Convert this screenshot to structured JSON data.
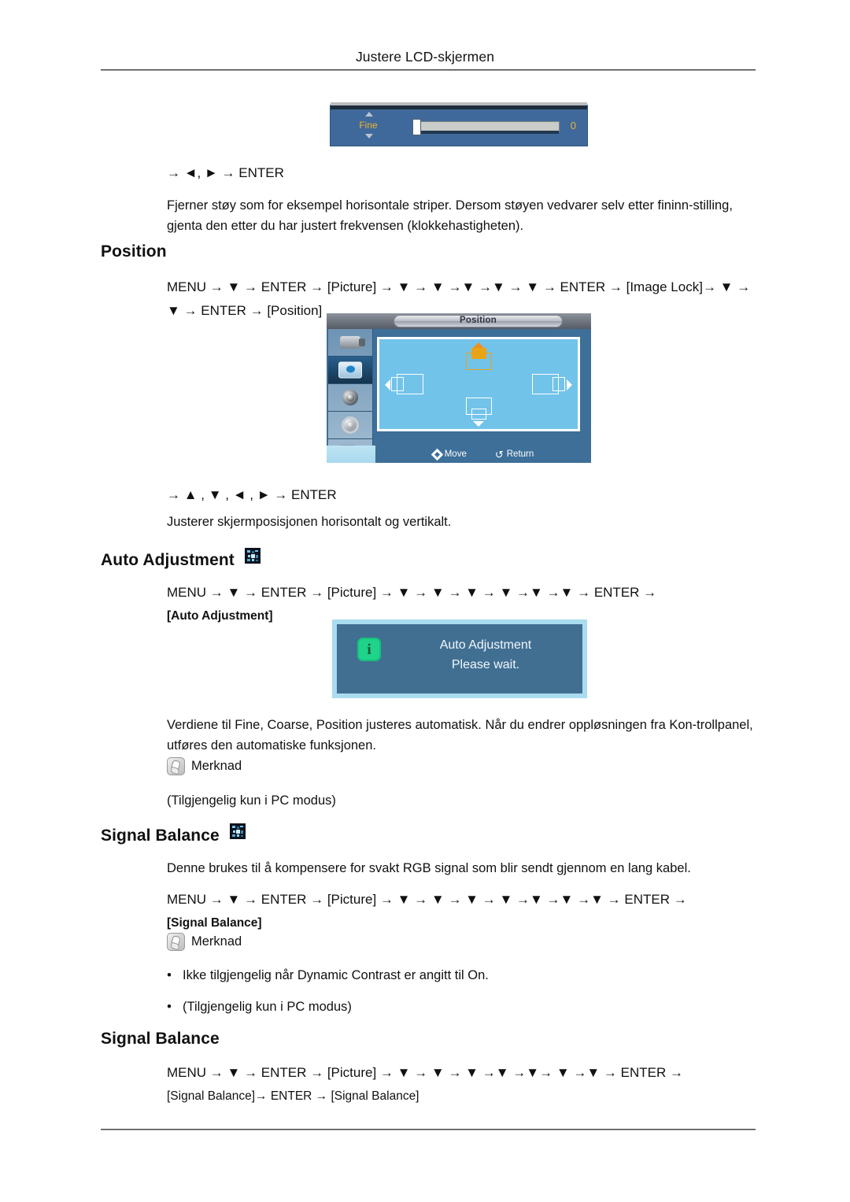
{
  "page": {
    "running_head": "Justere LCD-skjermen"
  },
  "fine_osd": {
    "label": "Fine",
    "value": "0",
    "up_icon": "triangle-up-icon",
    "down_icon": "triangle-down-icon"
  },
  "fine_section": {
    "keypath": "→ ◄, ► → ENTER",
    "description": "Fjerner støy som for eksempel horisontale striper. Dersom støyen vedvarer selv etter fininn-stilling, gjenta den etter du har justert frekvensen (klokkehastigheten)."
  },
  "position_section": {
    "heading": "Position",
    "path_line1": "MENU → ▼ → ENTER → [Picture] → ▼ → ▼ →▼ →▼ → ▼ → ENTER → [Image Lock]→ ▼ →",
    "path_line2": "▼ → ENTER → [Position]",
    "path_tokens": [
      "MENU",
      "ENTER",
      "Picture",
      "ENTER",
      "Image Lock",
      "ENTER",
      "Position"
    ],
    "keypath": "→ ▲ , ▼ , ◄ , ► → ENTER",
    "description": "Justerer skjermposisjonen horisontalt og vertikalt."
  },
  "position_osd": {
    "title": "Position",
    "sidebar": [
      {
        "name": "input-icon",
        "selected": false
      },
      {
        "name": "picture-icon",
        "selected": true
      },
      {
        "name": "sound-icon",
        "selected": false
      },
      {
        "name": "setup-icon",
        "selected": false
      },
      {
        "name": "multi-control-icon",
        "selected": false
      }
    ],
    "markers": [
      "up",
      "left",
      "right",
      "down"
    ],
    "footer": {
      "move": "Move",
      "return": "Return"
    }
  },
  "auto_adjustment_section": {
    "heading": "Auto Adjustment",
    "badge": "pc-mode-badge-icon",
    "path_line1": "MENU → ▼ → ENTER → [Picture] → ▼ → ▼ → ▼ → ▼ →▼ →▼ → ENTER →",
    "path_line2": "[Auto Adjustment]",
    "description": "Verdiene til Fine, Coarse, Position justeres automatisk. Når du endrer oppløsningen fra Kon-trollpanel, utføres den automatiske funksjonen.",
    "note_label": "Merknad",
    "note_text": "(Tilgjengelig kun i PC modus)"
  },
  "auto_adjustment_dialog": {
    "icon": "info-icon",
    "line1": "Auto Adjustment",
    "line2": "Please wait."
  },
  "signal_balance_section": {
    "heading": "Signal Balance",
    "badge": "pc-mode-badge-icon",
    "description": "Denne brukes til å kompensere for svakt RGB signal som blir sendt gjennom en lang kabel.",
    "path_line1": "MENU → ▼ → ENTER → [Picture] → ▼ → ▼ → ▼ → ▼ →▼ →▼ →▼ → ENTER →",
    "path_line2": "[Signal Balance]",
    "note_label": "Merknad",
    "bullets": [
      "Ikke tilgjengelig når Dynamic Contrast er angitt til On.",
      "(Tilgjengelig kun i PC modus)"
    ]
  },
  "signal_balance_sub_section": {
    "heading": "Signal Balance",
    "path_line1": "MENU → ▼ → ENTER → [Picture] → ▼ → ▼ → ▼ →▼ →▼→ ▼ →▼ → ENTER →",
    "path_line2": "[Signal Balance]→ ENTER → [Signal Balance]"
  },
  "colors": {
    "osd_blue": "#3d6f99",
    "osd_stage": "#72c3ea",
    "osd_gold": "#f0b429",
    "dialog_border": "#a9dcee",
    "dialog_bg": "#416f92",
    "info_green": "#1fd38a"
  }
}
